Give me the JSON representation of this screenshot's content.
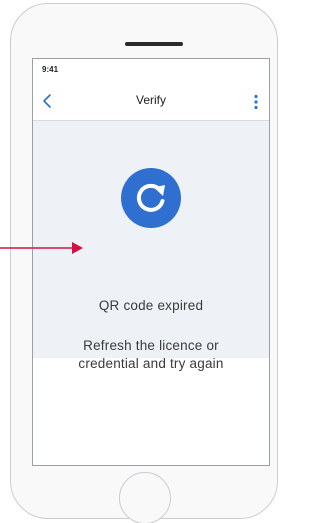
{
  "status_bar": {
    "time": "9:41"
  },
  "nav": {
    "title": "Verify",
    "back_icon": "chevron-left-icon",
    "menu_icon": "vertical-ellipsis-icon"
  },
  "content": {
    "icon": "refresh-icon",
    "title": "QR code expired",
    "message": "Refresh the licence or credential and try again"
  },
  "colors": {
    "accent_blue": "#2f6fd0",
    "callout_red": "#d31140",
    "content_background": "#eef2f7"
  }
}
